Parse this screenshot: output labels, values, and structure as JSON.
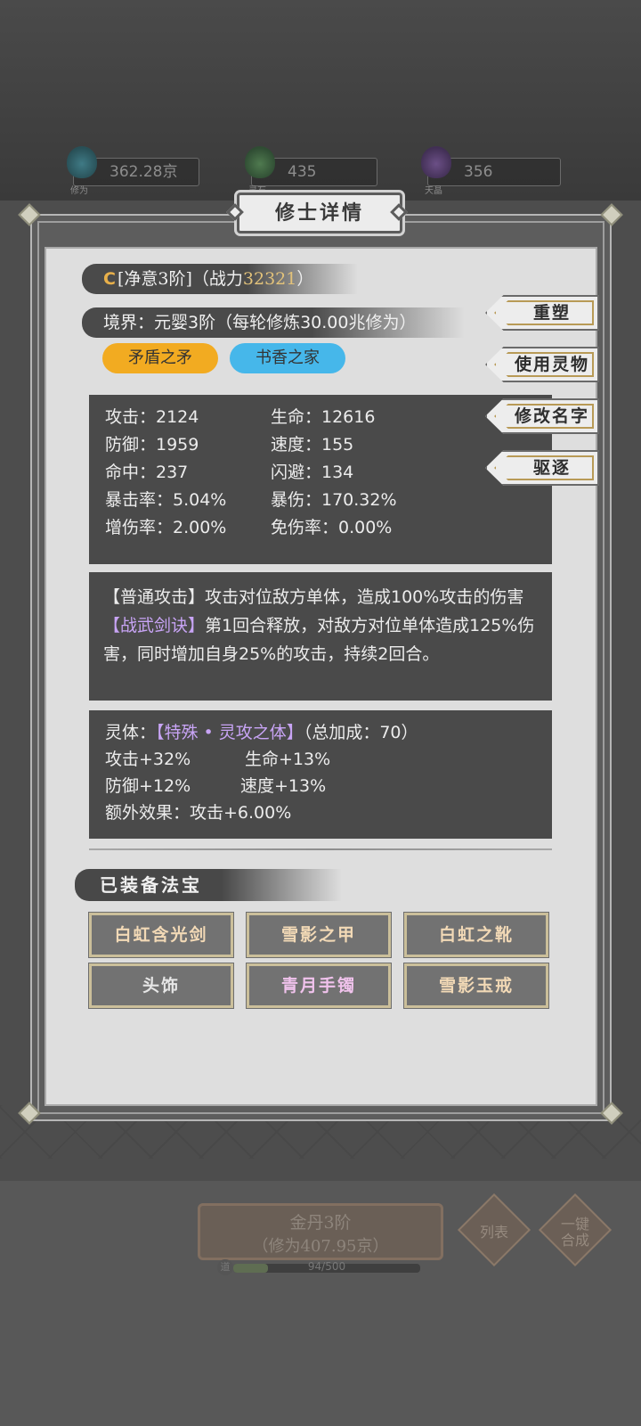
{
  "resources": [
    {
      "caption": "修为",
      "value": "362.28京",
      "icon": "cultivation-icon",
      "color": "#3f7a85"
    },
    {
      "caption": "灵石",
      "value": "435",
      "icon": "spirit-stone-icon",
      "color": "#4f7a4f"
    },
    {
      "caption": "天晶",
      "value": "356",
      "icon": "sky-crystal-icon",
      "color": "#6b4f86"
    }
  ],
  "dialog": {
    "title": "修士详情",
    "header": {
      "grade": "C",
      "name": "[净意3阶]",
      "power_prefix": "（战力",
      "power_value": "32321",
      "power_suffix": "）",
      "realm": "境界：元婴3阶（每轮修炼30.00兆修为）"
    },
    "tags": [
      {
        "label": "矛盾之矛",
        "color": "#f2ab21"
      },
      {
        "label": "书香之家",
        "color": "#46b7ea"
      }
    ],
    "stats": [
      [
        "攻击：2124",
        "生命：12616"
      ],
      [
        "防御：1959",
        "速度：155"
      ],
      [
        "命中：237",
        "闪避：134"
      ],
      [
        "暴击率：5.04%",
        "暴伤：170.32%"
      ],
      [
        "增伤率：2.00%",
        "免伤率：0.00%"
      ]
    ],
    "skills": {
      "normal": "【普通攻击】攻击对位敌方单体，造成100%攻击的伤害",
      "special_name": "【战武剑诀】",
      "special_desc": "第1回合释放，对敌方对位单体造成125%伤害，同时增加自身25%的攻击，持续2回合。"
    },
    "physique": {
      "label": "灵体：",
      "name": "【特殊 • 灵攻之体】",
      "total": "（总加成：70）",
      "bonuses": [
        [
          "攻击+32%",
          "生命+13%"
        ],
        [
          "防御+12%",
          "速度+13%"
        ]
      ],
      "extra": "额外效果：攻击+6.00%"
    },
    "side_buttons": [
      "重塑",
      "使用灵物",
      "修改名字",
      "驱逐"
    ],
    "equipment_title": "已装备法宝",
    "equipment": [
      {
        "label": "白虹含光剑",
        "kind": "normal"
      },
      {
        "label": "雪影之甲",
        "kind": "normal"
      },
      {
        "label": "白虹之靴",
        "kind": "normal"
      },
      {
        "label": "头饰",
        "kind": "empty"
      },
      {
        "label": "青月手镯",
        "kind": "purple"
      },
      {
        "label": "雪影玉戒",
        "kind": "normal"
      }
    ]
  },
  "bottom": {
    "main_line1": "金丹3阶",
    "main_line2": "（修为407.95京）",
    "list_button": "列表",
    "merge_button": "一键合成",
    "progress_text": "94/500",
    "progress_fraction": 0.188
  }
}
